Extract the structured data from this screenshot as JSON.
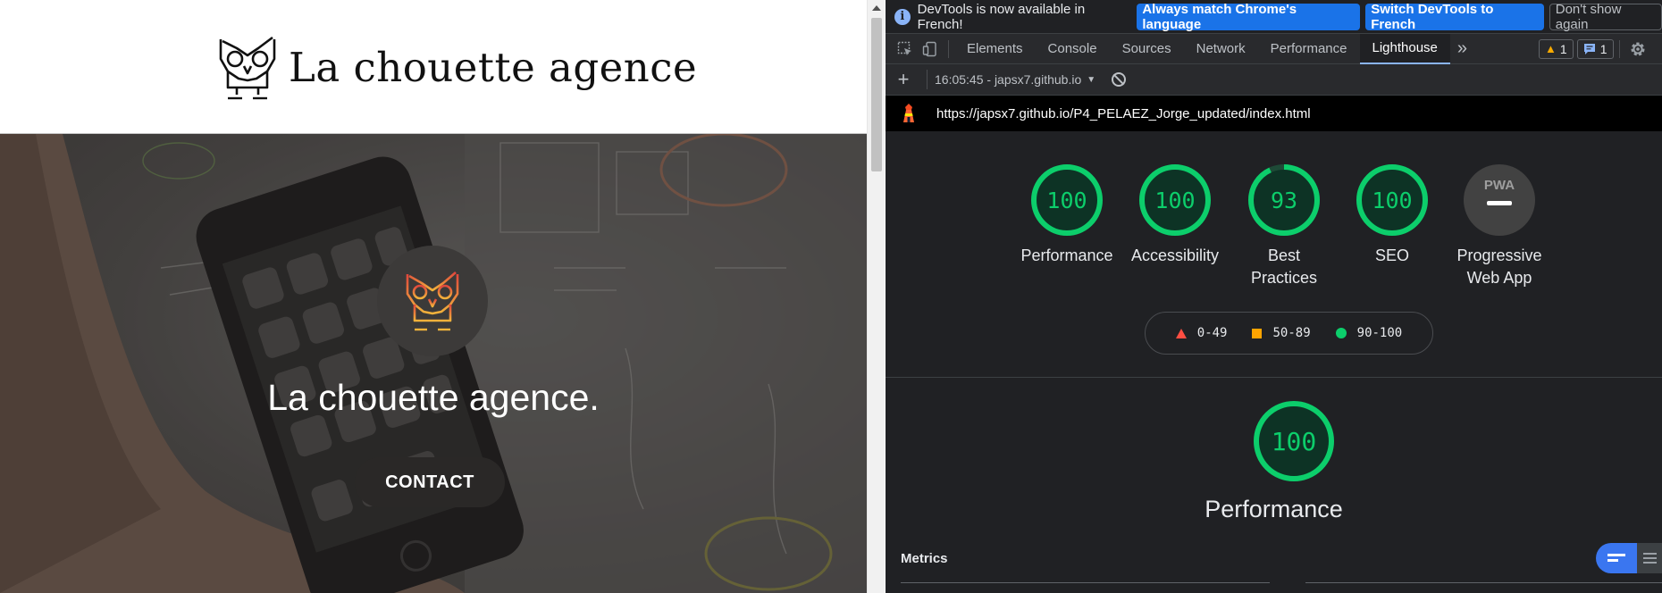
{
  "site": {
    "brand_name": "La chouette agence",
    "hero_title": "La chouette agence.",
    "contact_label": "CONTACT"
  },
  "devtools": {
    "infobar": {
      "message": "DevTools is now available in French!",
      "match_language": "Always match Chrome's language",
      "switch_french": "Switch DevTools to French",
      "dont_show": "Don't show again"
    },
    "tabs": [
      {
        "label": "Elements"
      },
      {
        "label": "Console"
      },
      {
        "label": "Sources"
      },
      {
        "label": "Network"
      },
      {
        "label": "Performance"
      },
      {
        "label": "Lighthouse"
      }
    ],
    "more_tabs": "»",
    "warnings_count": "1",
    "messages_count": "1",
    "lighthouse": {
      "add": "+",
      "report_select": "16:05:45 - japsx7.github.io",
      "url": "https://japsx7.github.io/P4_PELAEZ_Jorge_updated/index.html",
      "scores": [
        {
          "label": "Performance",
          "value": 100
        },
        {
          "label": "Accessibility",
          "value": 100
        },
        {
          "label": "Best Practices",
          "value": 93
        },
        {
          "label": "SEO",
          "value": 100
        },
        {
          "label": "Progressive Web App",
          "value": null,
          "badge": "PWA"
        }
      ],
      "legend": [
        {
          "range": "0-49",
          "color": "#ff4e42",
          "shape": "triangle"
        },
        {
          "range": "50-89",
          "color": "#ffa400",
          "shape": "square"
        },
        {
          "range": "90-100",
          "color": "#0cce6b",
          "shape": "circle"
        }
      ],
      "performance_score": 100,
      "performance_title": "Performance",
      "metrics_label": "Metrics"
    }
  },
  "colors": {
    "pass": "#0cce6b",
    "devtools_bg": "#202124",
    "accent_blue": "#1a73e8"
  }
}
